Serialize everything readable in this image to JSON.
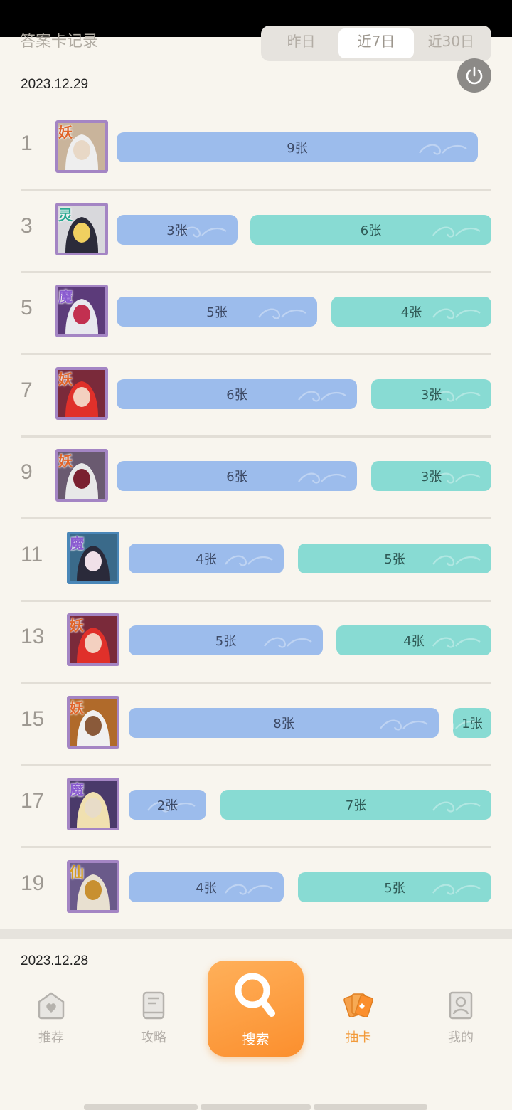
{
  "header": {
    "title": "答案卡记录",
    "tabs": [
      "昨日",
      "近7日",
      "近30日"
    ],
    "active_tab": 1
  },
  "date_current": "2023.12.29",
  "date_next": "2023.12.28",
  "rows": [
    {
      "rank": "1",
      "badge": "妖",
      "bars": [
        {
          "label": "9张",
          "type": "blue"
        }
      ]
    },
    {
      "rank": "3",
      "badge": "灵",
      "bars": [
        {
          "label": "3张",
          "type": "blue"
        },
        {
          "label": "6张",
          "type": "teal"
        }
      ]
    },
    {
      "rank": "5",
      "badge": "魔",
      "bars": [
        {
          "label": "5张",
          "type": "blue"
        },
        {
          "label": "4张",
          "type": "teal"
        }
      ]
    },
    {
      "rank": "7",
      "badge": "妖",
      "bars": [
        {
          "label": "6张",
          "type": "blue"
        },
        {
          "label": "3张",
          "type": "teal"
        }
      ]
    },
    {
      "rank": "9",
      "badge": "妖",
      "bars": [
        {
          "label": "6张",
          "type": "blue"
        },
        {
          "label": "3张",
          "type": "teal"
        }
      ]
    },
    {
      "rank": "11",
      "badge": "魔",
      "bars": [
        {
          "label": "4张",
          "type": "blue"
        },
        {
          "label": "5张",
          "type": "teal"
        }
      ]
    },
    {
      "rank": "13",
      "badge": "妖",
      "bars": [
        {
          "label": "5张",
          "type": "blue"
        },
        {
          "label": "4张",
          "type": "teal"
        }
      ]
    },
    {
      "rank": "15",
      "badge": "妖",
      "bars": [
        {
          "label": "8张",
          "type": "blue"
        },
        {
          "label": "1张",
          "type": "teal"
        }
      ]
    },
    {
      "rank": "17",
      "badge": "魔",
      "bars": [
        {
          "label": "2张",
          "type": "blue"
        },
        {
          "label": "7张",
          "type": "teal"
        }
      ]
    },
    {
      "rank": "19",
      "badge": "仙",
      "bars": [
        {
          "label": "4张",
          "type": "blue"
        },
        {
          "label": "5张",
          "type": "teal"
        }
      ]
    }
  ],
  "nav": {
    "items": [
      "推荐",
      "攻略",
      "搜索",
      "抽卡",
      "我的"
    ],
    "active": "抽卡"
  },
  "colors": {
    "accent": "#f29a3a",
    "bar_blue": "#9cbcec",
    "bar_teal": "#88dbd3"
  }
}
